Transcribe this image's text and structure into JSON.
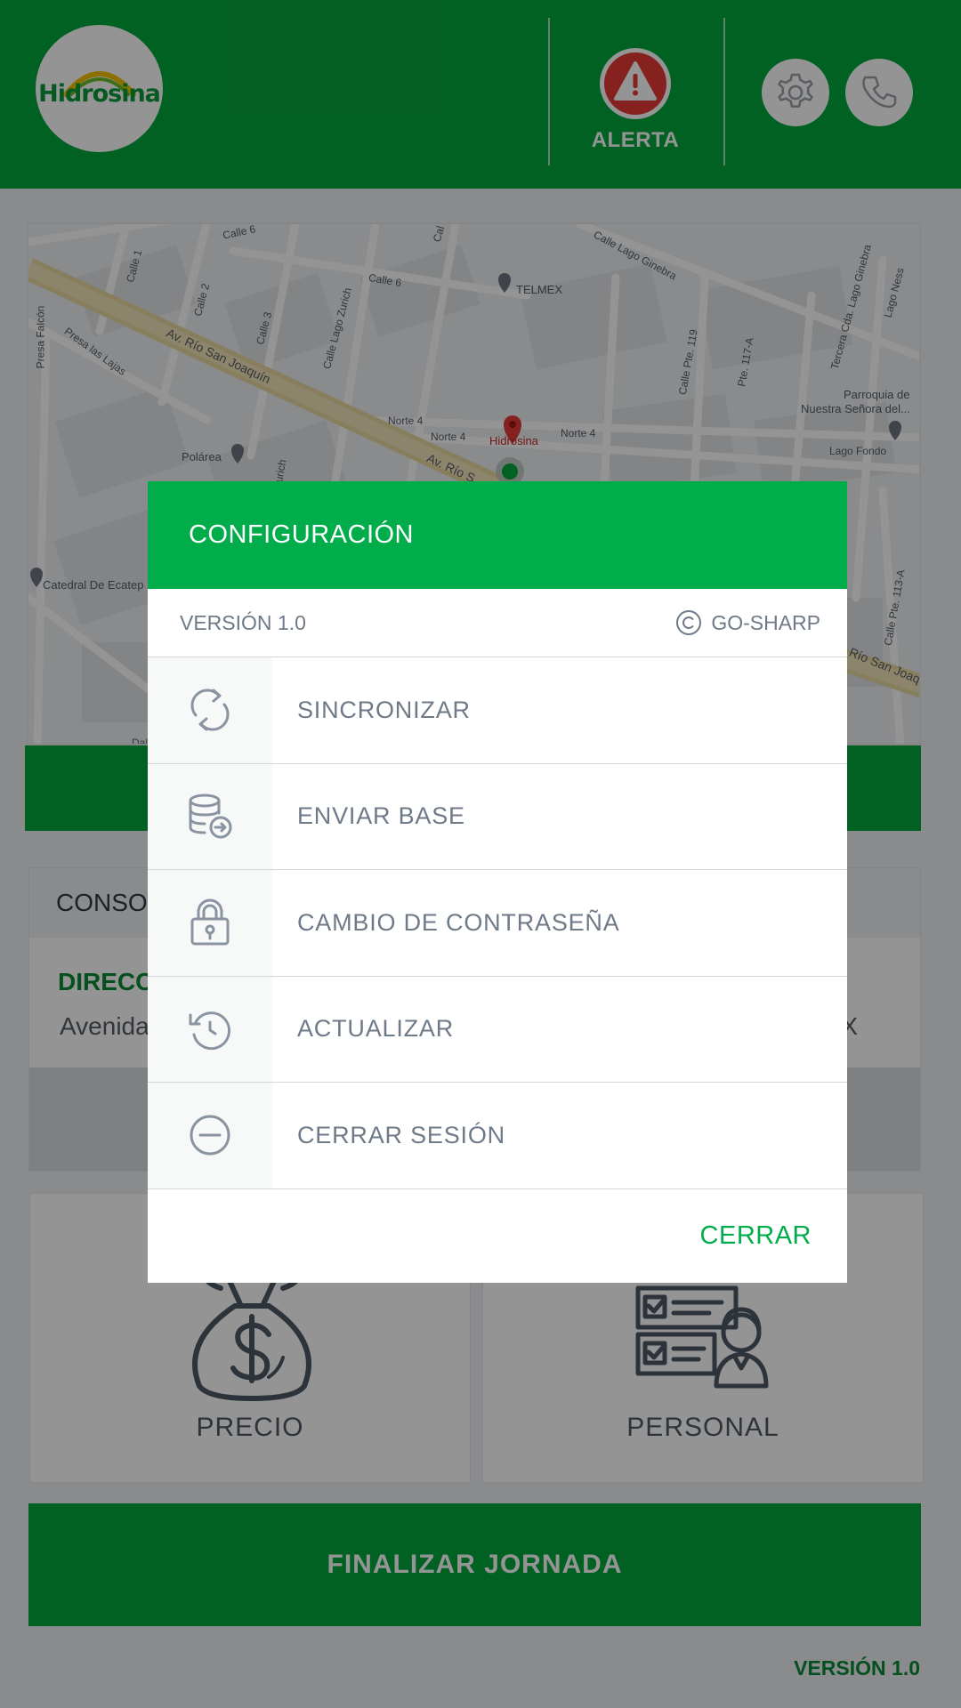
{
  "header": {
    "logo_text": "Hidrosina",
    "alert_label": "ALERTA"
  },
  "map": {
    "labels": {
      "calle6a": "Calle 6",
      "calle6b": "Calle 6",
      "calle1": "Calle 1",
      "calle2": "Calle 2",
      "calle3": "Calle 3",
      "cal": "Cal",
      "lagoGinebra": "Calle Lago Ginebra",
      "lagoZurich": "Calle Lago Zurich",
      "telmex": "TELMEX",
      "presaFalcon": "Presa Falcón",
      "presaLajas": "Presa las Lajas",
      "rioSanJoaquin": "Av. Río San Joaquín",
      "norte4a": "Norte 4",
      "norte4b": "Norte 4",
      "norte4c": "Norte 4",
      "hidrosina": "Hidrosina",
      "polarea": "Polárea",
      "zurich": "Zurich",
      "avRio": "Av. Río S",
      "calle119": "Calle Pte. 119",
      "calle117": "Pte. 117-A",
      "terceraGinebra": "Tercera Cda. Lago Ginebra",
      "lagoNess": "Lago Ness",
      "parroquia1": "Parroquia de",
      "parroquia2": "Nuestra Señora del...",
      "lagoFondo": "Lago Fondo",
      "catedral": "Catedral De Ecatep",
      "calle113": "Calle Pte. 113-A",
      "rioSanJoaq2": "Río San Joaq",
      "dal": "Dal"
    }
  },
  "info": {
    "header": "CONSO",
    "label": "DIRECC",
    "value": "Avenida",
    "right_value": "X"
  },
  "tiles": {
    "price_label": "PRECIO",
    "staff_label": "PERSONAL"
  },
  "finish_label": "FINALIZAR JORNADA",
  "bottom_version": "VERSIÓN 1.0",
  "dialog": {
    "title": "CONFIGURACIÓN",
    "version": "VERSIÓN 1.0",
    "brand": "GO-SHARP",
    "items": [
      {
        "label": "SINCRONIZAR",
        "icon": "sync-icon"
      },
      {
        "label": "ENVIAR BASE",
        "icon": "database-send-icon"
      },
      {
        "label": "CAMBIO DE CONTRASEÑA",
        "icon": "lock-icon"
      },
      {
        "label": "ACTUALIZAR",
        "icon": "refresh-icon"
      },
      {
        "label": "CERRAR SESIÓN",
        "icon": "minus-circle-icon"
      }
    ],
    "close_label": "CERRAR"
  },
  "colors": {
    "brand_green": "#03a73c",
    "dialog_green": "#00ad4a",
    "alert_red": "#e53935",
    "overlay": "rgba(0,0,0,0.42)"
  }
}
